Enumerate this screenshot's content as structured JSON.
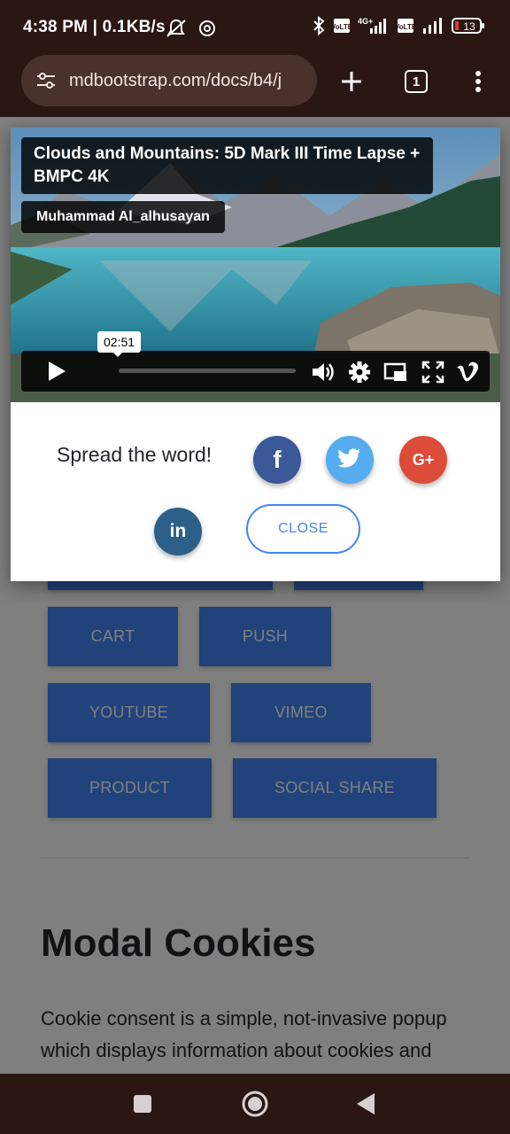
{
  "status_bar": {
    "time": "4:38 PM | 0.1KB/s",
    "icons": [
      "mute-icon",
      "app-icon",
      "bluetooth-icon",
      "volte-icon",
      "signal-4g-icon",
      "volte-icon",
      "signal-icon",
      "battery-icon"
    ],
    "battery_level": "13"
  },
  "browser": {
    "url": "mdbootstrap.com/docs/b4/j",
    "tab_count": "1",
    "icons": [
      "site-settings-icon",
      "new-tab-icon",
      "tabs-icon",
      "menu-icon"
    ]
  },
  "modal": {
    "video": {
      "title": "Clouds and Mountains: 5D Mark III Time Lapse + BMPC 4K",
      "author": "Muhammad Al_alhusayan",
      "tooltip_time": "02:51",
      "controls": [
        "play-icon",
        "volume-icon",
        "settings-icon",
        "pip-icon",
        "fullscreen-icon",
        "vimeo-icon"
      ]
    },
    "spread_text": "Spread the word!",
    "social": [
      {
        "name": "facebook",
        "glyph": "f",
        "color": "#3b5998"
      },
      {
        "name": "twitter",
        "glyph": "t",
        "color": "#55acee"
      },
      {
        "name": "google-plus",
        "glyph": "G+",
        "color": "#dd4b39"
      },
      {
        "name": "linkedin",
        "glyph": "in",
        "color": "#0082ca"
      }
    ],
    "close_label": "CLOSE"
  },
  "page": {
    "buttons": [
      "CART",
      "PUSH",
      "YOUTUBE",
      "VIMEO",
      "PRODUCT",
      "SOCIAL SHARE"
    ],
    "heading": "Modal Cookies",
    "paragraph": "Cookie consent is a simple, not-invasive popup which displays information about cookies and privacy policy."
  },
  "colors": {
    "primary": "#4285f4",
    "browser_bg": "#2a1612"
  },
  "nav": [
    "recents-icon",
    "home-icon",
    "back-icon"
  ]
}
